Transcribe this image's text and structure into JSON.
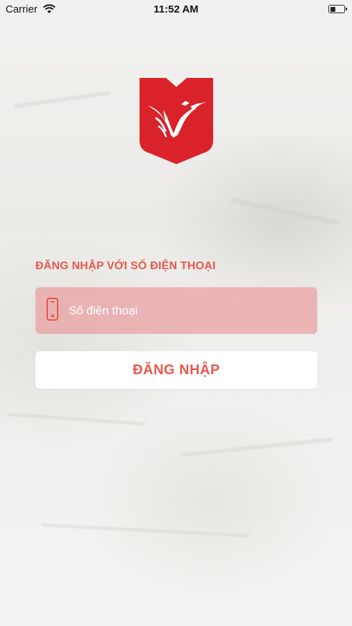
{
  "status_bar": {
    "carrier": "Carrier",
    "time": "11:52 AM",
    "wifi_icon": "wifi-icon",
    "battery_icon": "battery-icon",
    "battery_level": 0.3
  },
  "logo": {
    "icon": "brand-shield-logo",
    "color": "#d9222a"
  },
  "login": {
    "heading": "ĐĂNG NHẬP VỚI SỐ ĐIỆN THOẠI",
    "phone_placeholder": "Số điện thoại",
    "phone_value": "",
    "phone_icon": "smartphone-icon",
    "button_label": "ĐĂNG NHẬP"
  },
  "colors": {
    "accent": "#e8574d",
    "field_background": "#e89c9c",
    "button_background": "#ffffff",
    "logo_red": "#d9222a"
  }
}
